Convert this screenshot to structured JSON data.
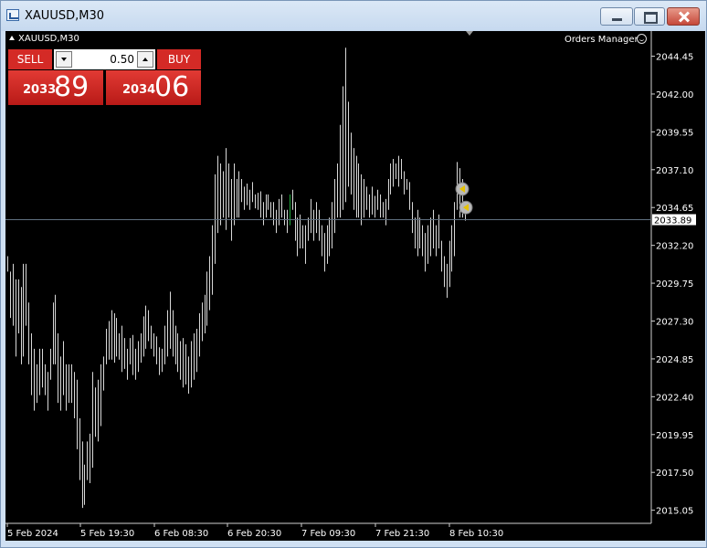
{
  "window": {
    "title": "XAUUSD,M30"
  },
  "chart": {
    "symbol_label": "XAUUSD,M30",
    "orders_manager_label": "Orders Manager",
    "current_price": "2033.89",
    "colors": {
      "background": "#000000",
      "bar": "#d8d8d8",
      "bar_highlight": "#1ea83a",
      "grid_line": "#5f6f80",
      "axis_text": "#ffffff"
    }
  },
  "trade_panel": {
    "sell_label": "SELL",
    "buy_label": "BUY",
    "lot_value": "0.50",
    "sell_price_major": "2033",
    "sell_price_minor": "89",
    "buy_price_major": "2034",
    "buy_price_minor": "06",
    "color": "#d42a26"
  },
  "chart_data": {
    "type": "bar",
    "yticks": [
      "2044.45",
      "2042.00",
      "2039.55",
      "2037.10",
      "2034.65",
      "2032.20",
      "2029.75",
      "2027.30",
      "2024.85",
      "2022.40",
      "2019.95",
      "2017.50",
      "2015.05"
    ],
    "xticks": [
      "5 Feb 2024",
      "5 Feb 19:30",
      "6 Feb 08:30",
      "6 Feb 20:30",
      "7 Feb 09:30",
      "7 Feb 21:30",
      "8 Feb 10:30"
    ],
    "ylim": [
      2014.2,
      2045.9
    ],
    "grid": false,
    "current_price_line": 2033.89,
    "order_markers": [
      2035.85,
      2034.65
    ],
    "bars": [
      [
        2030.5,
        2031.5
      ],
      [
        2027.5,
        2030.5
      ],
      [
        2027.0,
        2031.0
      ],
      [
        2025.0,
        2030.0
      ],
      [
        2026.5,
        2030.0
      ],
      [
        2024.5,
        2029.5
      ],
      [
        2025.0,
        2031.0
      ],
      [
        2027.0,
        2031.0
      ],
      [
        2024.5,
        2028.5
      ],
      [
        2022.5,
        2026.5
      ],
      [
        2021.5,
        2025.5
      ],
      [
        2022.0,
        2024.5
      ],
      [
        2022.5,
        2025.5
      ],
      [
        2023.0,
        2025.5
      ],
      [
        2022.5,
        2024.5
      ],
      [
        2021.5,
        2024.0
      ],
      [
        2023.5,
        2025.5
      ],
      [
        2024.5,
        2028.5
      ],
      [
        2024.5,
        2029.0
      ],
      [
        2022.0,
        2026.5
      ],
      [
        2021.5,
        2025.0
      ],
      [
        2022.5,
        2026.0
      ],
      [
        2021.5,
        2024.5
      ],
      [
        2022.0,
        2024.5
      ],
      [
        2022.0,
        2024.5
      ],
      [
        2021.0,
        2024.0
      ],
      [
        2019.0,
        2023.5
      ],
      [
        2017.0,
        2021.0
      ],
      [
        2015.2,
        2019.5
      ],
      [
        2015.4,
        2018.0
      ],
      [
        2017.0,
        2019.5
      ],
      [
        2016.8,
        2020.0
      ],
      [
        2017.8,
        2024.0
      ],
      [
        2019.8,
        2023.0
      ],
      [
        2019.5,
        2023.5
      ],
      [
        2020.5,
        2024.5
      ],
      [
        2022.8,
        2025.0
      ],
      [
        2024.5,
        2026.8
      ],
      [
        2024.8,
        2027.3
      ],
      [
        2024.8,
        2028.0
      ],
      [
        2024.6,
        2027.8
      ],
      [
        2025.0,
        2027.5
      ],
      [
        2024.8,
        2026.5
      ],
      [
        2024.0,
        2027.0
      ],
      [
        2024.2,
        2026.2
      ],
      [
        2023.5,
        2025.5
      ],
      [
        2024.5,
        2026.2
      ],
      [
        2023.8,
        2026.4
      ],
      [
        2023.5,
        2025.5
      ],
      [
        2024.0,
        2026.0
      ],
      [
        2024.6,
        2026.5
      ],
      [
        2025.0,
        2027.6
      ],
      [
        2025.5,
        2028.3
      ],
      [
        2026.0,
        2028.0
      ],
      [
        2025.5,
        2027.0
      ],
      [
        2025.0,
        2026.5
      ],
      [
        2024.5,
        2026.3
      ],
      [
        2023.8,
        2025.6
      ],
      [
        2024.0,
        2025.5
      ],
      [
        2024.5,
        2027.0
      ],
      [
        2025.0,
        2028.0
      ],
      [
        2025.5,
        2029.2
      ],
      [
        2025.0,
        2028.0
      ],
      [
        2024.5,
        2027.0
      ],
      [
        2024.0,
        2026.5
      ],
      [
        2023.5,
        2026.0
      ],
      [
        2023.0,
        2026.2
      ],
      [
        2023.2,
        2025.8
      ],
      [
        2022.6,
        2025.0
      ],
      [
        2023.0,
        2026.0
      ],
      [
        2023.5,
        2026.5
      ],
      [
        2024.0,
        2026.8
      ],
      [
        2025.0,
        2027.8
      ],
      [
        2026.0,
        2028.5
      ],
      [
        2026.5,
        2029.0
      ],
      [
        2027.0,
        2030.5
      ],
      [
        2028.0,
        2031.5
      ],
      [
        2029.0,
        2033.5
      ],
      [
        2031.0,
        2036.8
      ],
      [
        2033.0,
        2038.0
      ],
      [
        2033.5,
        2037.5
      ],
      [
        2034.0,
        2037.0
      ],
      [
        2033.2,
        2038.5
      ],
      [
        2034.0,
        2037.5
      ],
      [
        2032.5,
        2036.5
      ],
      [
        2033.5,
        2037.5
      ],
      [
        2034.0,
        2036.5
      ],
      [
        2034.0,
        2037.0
      ],
      [
        2035.0,
        2036.5
      ],
      [
        2034.5,
        2036.0
      ],
      [
        2034.8,
        2036.2
      ],
      [
        2034.5,
        2035.8
      ],
      [
        2035.0,
        2036.3
      ],
      [
        2034.6,
        2035.5
      ],
      [
        2034.5,
        2035.6
      ],
      [
        2034.0,
        2035.7
      ],
      [
        2033.5,
        2035.0
      ],
      [
        2034.0,
        2035.5
      ],
      [
        2034.5,
        2035.5
      ],
      [
        2034.0,
        2035.0
      ],
      [
        2033.5,
        2035.0
      ],
      [
        2033.0,
        2034.5
      ],
      [
        2033.5,
        2035.2
      ],
      [
        2034.0,
        2035.5
      ],
      [
        2033.5,
        2034.5
      ],
      [
        2033.0,
        2034.5
      ],
      [
        2033.5,
        2035.5
      ],
      [
        2034.5,
        2035.8
      ],
      [
        2032.5,
        2035.0
      ],
      [
        2031.5,
        2034.0
      ],
      [
        2032.0,
        2034.2
      ],
      [
        2032.0,
        2033.5
      ],
      [
        2031.0,
        2033.5
      ],
      [
        2032.5,
        2034.0
      ],
      [
        2033.0,
        2035.2
      ],
      [
        2032.5,
        2034.5
      ],
      [
        2033.0,
        2035.0
      ],
      [
        2032.5,
        2034.5
      ],
      [
        2031.5,
        2033.5
      ],
      [
        2030.5,
        2033.0
      ],
      [
        2031.0,
        2033.5
      ],
      [
        2031.5,
        2034.0
      ],
      [
        2032.0,
        2035.0
      ],
      [
        2033.0,
        2036.5
      ],
      [
        2034.0,
        2037.5
      ],
      [
        2034.0,
        2040.0
      ],
      [
        2034.5,
        2042.5
      ],
      [
        2035.0,
        2045.0
      ],
      [
        2036.0,
        2041.5
      ],
      [
        2035.5,
        2039.5
      ],
      [
        2034.5,
        2038.5
      ],
      [
        2034.0,
        2038.0
      ],
      [
        2034.0,
        2037.5
      ],
      [
        2033.5,
        2036.8
      ],
      [
        2034.0,
        2036.5
      ],
      [
        2034.5,
        2036.0
      ],
      [
        2034.0,
        2035.5
      ],
      [
        2034.2,
        2036.0
      ],
      [
        2034.0,
        2035.4
      ],
      [
        2034.5,
        2035.8
      ],
      [
        2034.0,
        2035.5
      ],
      [
        2034.0,
        2035.0
      ],
      [
        2033.5,
        2035.2
      ],
      [
        2034.5,
        2036.5
      ],
      [
        2035.5,
        2037.5
      ],
      [
        2036.0,
        2037.8
      ],
      [
        2036.5,
        2037.5
      ],
      [
        2036.0,
        2038.0
      ],
      [
        2036.5,
        2037.8
      ],
      [
        2035.5,
        2037.0
      ],
      [
        2035.8,
        2036.5
      ],
      [
        2034.5,
        2036.3
      ],
      [
        2033.0,
        2035.0
      ],
      [
        2032.0,
        2034.0
      ],
      [
        2031.5,
        2034.5
      ],
      [
        2032.0,
        2034.0
      ],
      [
        2031.5,
        2033.5
      ],
      [
        2030.5,
        2033.0
      ],
      [
        2031.0,
        2033.5
      ],
      [
        2031.5,
        2034.0
      ],
      [
        2032.0,
        2034.5
      ],
      [
        2031.5,
        2033.5
      ],
      [
        2032.0,
        2034.2
      ],
      [
        2030.5,
        2032.5
      ],
      [
        2029.5,
        2031.5
      ],
      [
        2028.8,
        2031.0
      ],
      [
        2029.5,
        2032.5
      ],
      [
        2030.5,
        2033.5
      ],
      [
        2031.5,
        2035.0
      ],
      [
        2034.5,
        2037.6
      ],
      [
        2034.0,
        2037.2
      ],
      [
        2034.0,
        2036.5
      ],
      [
        2033.8,
        2034.8
      ]
    ],
    "highlight_bar_index": 106
  }
}
